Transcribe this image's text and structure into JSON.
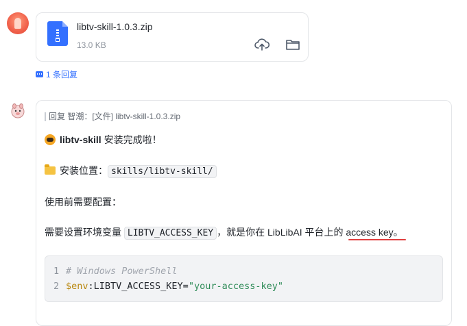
{
  "file_message": {
    "file_name": "libtv-skill-1.0.3.zip",
    "file_size": "13.0 KB",
    "upload_icon": "cloud-upload-icon",
    "folder_icon": "folder-icon"
  },
  "thread": {
    "reply_count_label": "1 条回复"
  },
  "bot_message": {
    "quote": "回复 智潮：[文件] libtv-skill-1.0.3.zip",
    "headline_name": "libtv-skill",
    "headline_rest": "安装完成啦！",
    "install_label": "安装位置：",
    "install_path": "skills/libtv-skill/",
    "config_heading": "使用前需要配置：",
    "env_prefix": "需要设置环境变量",
    "env_var": "LIBTV_ACCESS_KEY",
    "env_middle": "，就是你在 LibLibAI 平台上的",
    "env_highlight": "access key",
    "env_end": "。",
    "code": {
      "line1_no": "1",
      "line1": "# Windows PowerShell",
      "line2_no": "2",
      "line2_var": "$env",
      "line2_key": ":LIBTV_ACCESS_KEY=",
      "line2_str": "\"your-access-key\""
    }
  },
  "colors": {
    "accent": "#3370ff",
    "underline": "#e03e3e"
  }
}
